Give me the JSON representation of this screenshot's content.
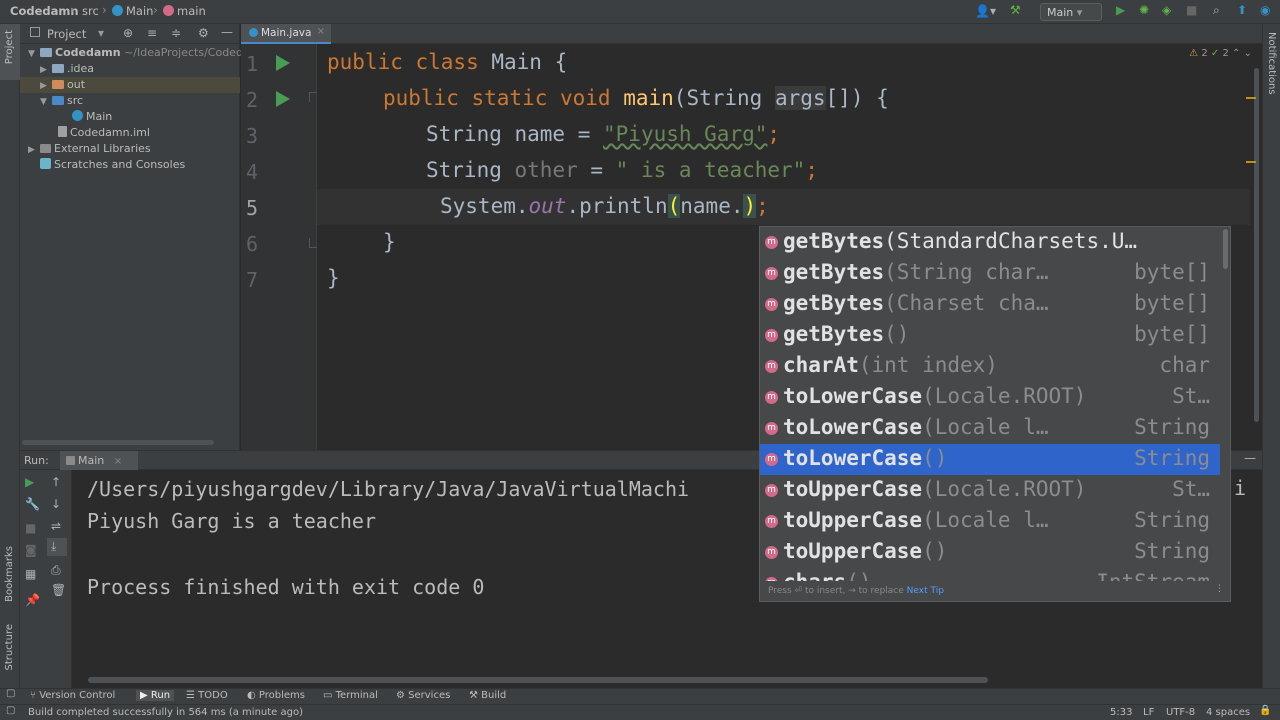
{
  "navbar": {
    "project": "Codedamn",
    "folder": "src",
    "class": "Main",
    "method": "main",
    "run_config": "Main"
  },
  "colors": {
    "accent": "#2f65ca",
    "run_green": "#499c54",
    "keyword": "#cc7832",
    "string": "#6a8759",
    "method": "#ffc66d"
  },
  "project_panel": {
    "title": "Project",
    "stripe_label": "Project",
    "tree": [
      {
        "label": "Codedamn",
        "extra": "~/IdeaProjects/Coded",
        "icon": "module-folder-icon"
      },
      {
        "label": ".idea",
        "icon": "folder-icon"
      },
      {
        "label": "out",
        "icon": "folder-icon"
      },
      {
        "label": "src",
        "icon": "source-folder-icon"
      },
      {
        "label": "Main",
        "icon": "class-icon"
      },
      {
        "label": "Codedamn.iml",
        "icon": "iml-file-icon"
      },
      {
        "label": "External Libraries",
        "icon": "library-icon"
      },
      {
        "label": "Scratches and Consoles",
        "icon": "scratches-icon"
      }
    ]
  },
  "editor": {
    "tab": "Main.java",
    "warnings": "2",
    "oks": "2",
    "line_numbers": [
      "1",
      "2",
      "3",
      "4",
      "5",
      "6",
      "7"
    ],
    "lines": {
      "l1": {
        "kw": "public class ",
        "rest": "Main {"
      },
      "l2": {
        "kw": "public static void ",
        "fn": "main",
        "rest": "(String ",
        "args": "args",
        "rest2": "[]) {"
      },
      "l3": {
        "a": "String name = ",
        "s": "\"Piyush Garg\"",
        "e": ";"
      },
      "l4": {
        "a": "String ",
        "b": "other",
        "c": " = ",
        "s": "\" is a teacher\"",
        "e": ";"
      },
      "l5": {
        "a": "System.",
        "b": "out",
        "c": ".println",
        "d": "(",
        "e": "name.",
        "f": ")",
        "g": ";"
      },
      "l6": "}",
      "l7": "}"
    }
  },
  "completion": {
    "items": [
      {
        "name": "getBytes",
        "args": "(StandardCharsets.U…",
        "type": ""
      },
      {
        "name": "getBytes",
        "args": "(String char…",
        "type": "byte[]"
      },
      {
        "name": "getBytes",
        "args": "(Charset cha…",
        "type": "byte[]"
      },
      {
        "name": "getBytes",
        "args": "()",
        "type": "byte[]"
      },
      {
        "name": "charAt",
        "args": "(int index)",
        "type": "char"
      },
      {
        "name": "toLowerCase",
        "args": "(Locale.ROOT)",
        "type": "St…"
      },
      {
        "name": "toLowerCase",
        "args": "(Locale l…",
        "type": "String"
      },
      {
        "name": "toLowerCase",
        "args": "()",
        "type": "String"
      },
      {
        "name": "toUpperCase",
        "args": "(Locale.ROOT)",
        "type": "St…"
      },
      {
        "name": "toUpperCase",
        "args": "(Locale l…",
        "type": "String"
      },
      {
        "name": "toUpperCase",
        "args": "()",
        "type": "String"
      },
      {
        "name": "chars",
        "args": "()",
        "type": "IntStream"
      }
    ],
    "selected_index": 7,
    "footer_hint": "Press ⏎ to insert, → to replace",
    "footer_link": "Next Tip"
  },
  "run_panel": {
    "label": "Run:",
    "tab": "Main",
    "console": [
      "/Users/piyushgargdev/Library/Java/JavaVirtualMachi",
      "Piyush Garg is a teacher",
      "",
      "Process finished with exit code 0"
    ],
    "console_overflow_char": "i"
  },
  "tool_tabs": [
    "Version Control",
    "Run",
    "TODO",
    "Problems",
    "Terminal",
    "Services",
    "Build"
  ],
  "left_stripe_bottom": [
    "Bookmarks",
    "Structure"
  ],
  "right_stripe": "Notifications",
  "status": {
    "message": "Build completed successfully in 564 ms (a minute ago)",
    "position": "5:33",
    "line_sep": "LF",
    "encoding": "UTF-8",
    "indent": "4 spaces"
  }
}
